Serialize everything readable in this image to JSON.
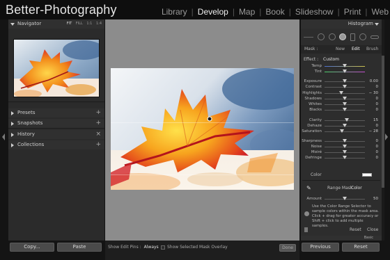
{
  "brand": "Better-Photography",
  "modules": [
    {
      "label": "Library",
      "active": false
    },
    {
      "label": "Develop",
      "active": true
    },
    {
      "label": "Map",
      "active": false
    },
    {
      "label": "Book",
      "active": false
    },
    {
      "label": "Slideshow",
      "active": false
    },
    {
      "label": "Print",
      "active": false
    },
    {
      "label": "Web",
      "active": false
    }
  ],
  "left_panel": {
    "navigator": {
      "title": "Navigator",
      "zooms": [
        "FIT",
        "FILL",
        "1:1",
        "1:4"
      ]
    },
    "sections": [
      {
        "label": "Presets",
        "action": "+"
      },
      {
        "label": "Snapshots",
        "action": "+"
      },
      {
        "label": "History",
        "action": "×"
      },
      {
        "label": "Collections",
        "action": "+"
      }
    ],
    "copy_button": "Copy...",
    "paste_button": "Paste"
  },
  "bottom_bar": {
    "edit_pins_label": "Show Edit Pins :",
    "edit_pins_value": "Always",
    "mask_overlay_label": "Show Selected Mask Overlay",
    "done_button": "Done"
  },
  "right_panel": {
    "histogram_title": "Histogram",
    "mask": {
      "label": "Mask :",
      "options": [
        "New",
        "Edit",
        "Brush"
      ],
      "active": "Edit"
    },
    "effect": {
      "label": "Effect :",
      "value": "Custom"
    },
    "sliders": [
      {
        "label": "Temp",
        "value": "",
        "pos": 0.5
      },
      {
        "label": "Tint",
        "value": "",
        "pos": 0.5
      },
      {
        "label": "Exposure",
        "value": "0.00",
        "pos": 0.5
      },
      {
        "label": "Contrast",
        "value": "0",
        "pos": 0.5
      },
      {
        "label": "Highlights",
        "value": "− 30",
        "pos": 0.42
      },
      {
        "label": "Shadows",
        "value": "0",
        "pos": 0.5
      },
      {
        "label": "Whites",
        "value": "0",
        "pos": 0.5
      },
      {
        "label": "Blacks",
        "value": "0",
        "pos": 0.5
      },
      {
        "label": "Clarity",
        "value": "15",
        "pos": 0.55
      },
      {
        "label": "Dehaze",
        "value": "0",
        "pos": 0.5
      },
      {
        "label": "Saturation",
        "value": "− 28",
        "pos": 0.43
      },
      {
        "label": "Sharpness",
        "value": "0",
        "pos": 0.5
      },
      {
        "label": "Noise",
        "value": "0",
        "pos": 0.5
      },
      {
        "label": "Moiré",
        "value": "0",
        "pos": 0.5
      },
      {
        "label": "Defringe",
        "value": "0",
        "pos": 0.5
      }
    ],
    "color_label": "Color",
    "range_mask": {
      "label": "Range Mask :",
      "value": "Color"
    },
    "amount": {
      "label": "Amount",
      "value": "50",
      "pos": 0.5
    },
    "info": "Use the Color Range Selector to sample colors within the mask area. Click + drag for greater accuracy or Shift + click to add multiple samples.",
    "reset_button": "Reset",
    "close_button": "Close",
    "detail_label": "Basic"
  },
  "footer": {
    "previous_button": "Previous",
    "reset_button": "Reset"
  }
}
